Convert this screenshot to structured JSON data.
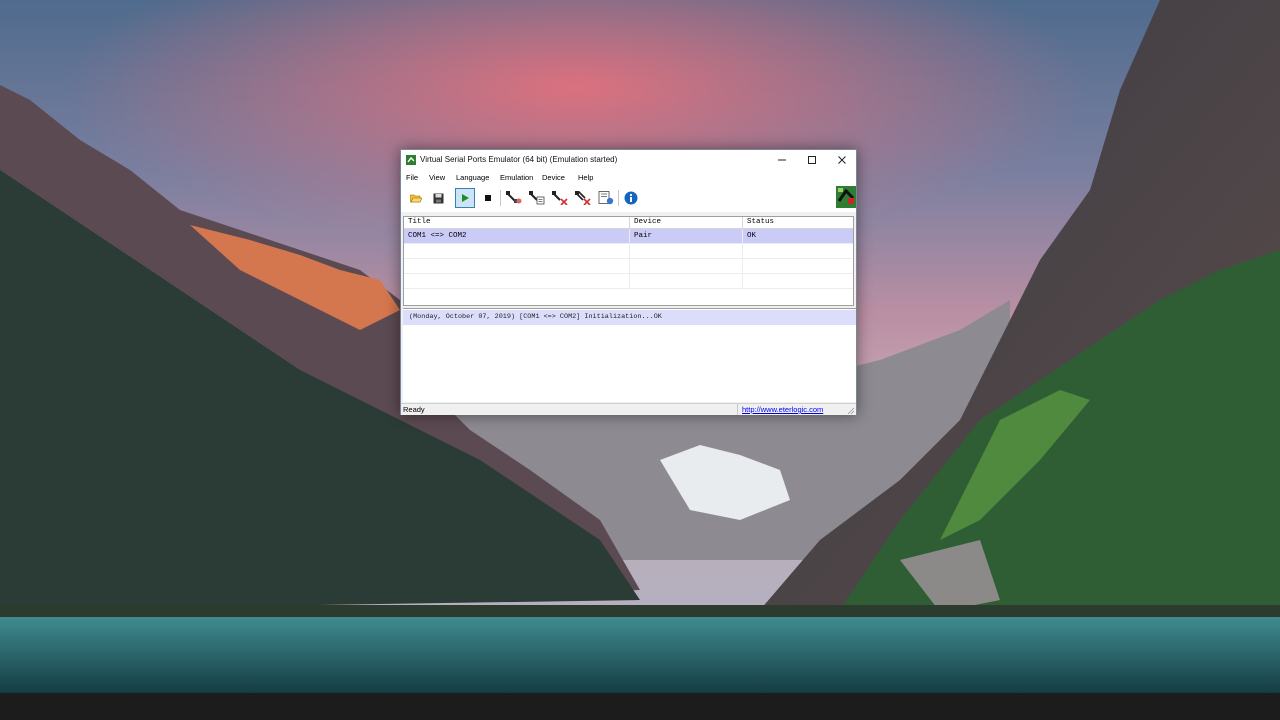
{
  "window": {
    "title": "Virtual Serial Ports Emulator (64 bit) (Emulation started)",
    "app_icon": "vspe-app-icon",
    "controls": [
      "minimize-icon",
      "maximize-icon",
      "close-icon"
    ]
  },
  "menu": {
    "items": [
      {
        "label": "File"
      },
      {
        "label": "View"
      },
      {
        "label": "Language"
      },
      {
        "label": "Emulation"
      },
      {
        "label": "Device"
      },
      {
        "label": "Help"
      }
    ]
  },
  "toolbar": {
    "buttons": [
      {
        "icon": "open-folder-icon"
      },
      {
        "icon": "save-icon"
      },
      {
        "icon": "start-emulation-icon",
        "active": true
      },
      {
        "icon": "stop-emulation-icon"
      },
      {
        "icon": "create-device-icon"
      },
      {
        "icon": "edit-device-icon"
      },
      {
        "icon": "remove-device-icon"
      },
      {
        "icon": "remove-all-devices-icon"
      },
      {
        "icon": "device-manager-icon"
      },
      {
        "icon": "info-icon"
      }
    ],
    "logo": "vspe-logo-icon"
  },
  "device_list": {
    "columns": [
      "Title",
      "Device",
      "Status"
    ],
    "rows": [
      {
        "title": "COM1 <=> COM2",
        "device": "Pair",
        "status": "OK",
        "selected": true
      },
      {
        "title": "",
        "device": "",
        "status": ""
      },
      {
        "title": "",
        "device": "",
        "status": ""
      },
      {
        "title": "",
        "device": "",
        "status": ""
      }
    ]
  },
  "log": {
    "lines": [
      "(Monday, October 07, 2019) [COM1 <=> COM2] Initialization...OK"
    ]
  },
  "statusbar": {
    "text": "Ready",
    "link": "http://www.eterlogic.com"
  },
  "colors": {
    "selection": "#cbcbf7",
    "log_highlight": "#dcdcfb",
    "accent_active": "#cce4f7",
    "link": "#0000ee"
  }
}
